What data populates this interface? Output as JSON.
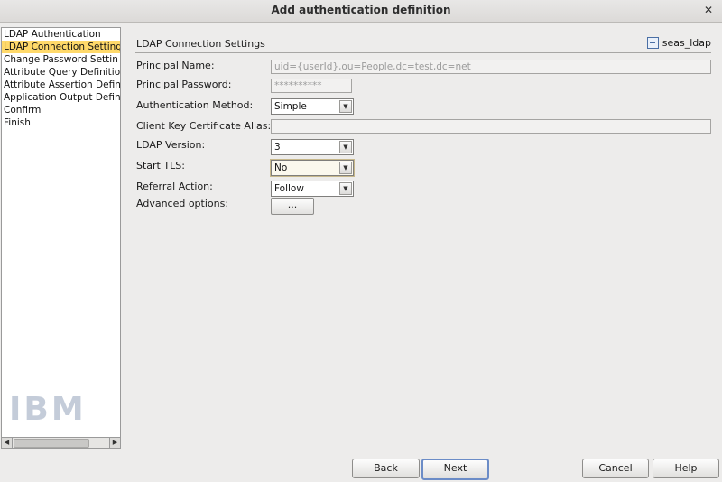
{
  "window": {
    "title": "Add authentication definition",
    "close_symbol": "✕"
  },
  "steps": [
    {
      "label": "LDAP Authentication",
      "active": false
    },
    {
      "label": "LDAP Connection Setting",
      "active": true
    },
    {
      "label": "Change Password Settin",
      "active": false
    },
    {
      "label": "Attribute Query Definitio",
      "active": false
    },
    {
      "label": "Attribute Assertion Defin",
      "active": false
    },
    {
      "label": "Application Output Defin",
      "active": false
    },
    {
      "label": "Confirm",
      "active": false
    },
    {
      "label": "Finish",
      "active": false
    }
  ],
  "logo": {
    "text": "IBM"
  },
  "scroll": {
    "left": "◀",
    "right": "▶"
  },
  "section": {
    "title": "LDAP Connection Settings",
    "connection_name": "seas_ldap",
    "connection_icon": "connection-icon"
  },
  "form": {
    "principal_name": {
      "label": "Principal Name:",
      "value": "uid={userId},ou=People,dc=test,dc=net"
    },
    "principal_password": {
      "label": "Principal Password:",
      "value": "**********"
    },
    "auth_method": {
      "label": "Authentication Method:",
      "value": "Simple"
    },
    "client_key_alias": {
      "label": "Client Key Certificate Alias:",
      "value": ""
    },
    "ldap_version": {
      "label": "LDAP Version:",
      "value": "3"
    },
    "start_tls": {
      "label": "Start TLS:",
      "value": "No"
    },
    "referral_action": {
      "label": "Referral Action:",
      "value": "Follow"
    },
    "advanced_options": {
      "label": "Advanced options:",
      "button": "..."
    },
    "drop_symbol": "▼"
  },
  "buttons": {
    "back": "Back",
    "next": "Next",
    "cancel": "Cancel",
    "help": "Help"
  }
}
